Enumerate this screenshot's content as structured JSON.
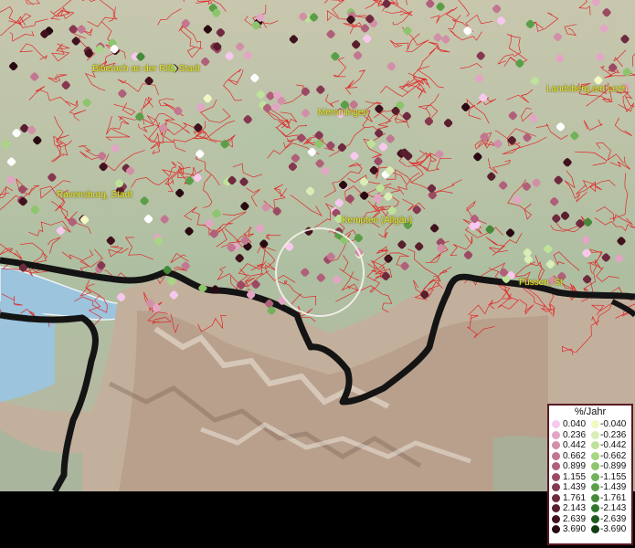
{
  "legend": {
    "title": "%/Jahr",
    "rows": [
      {
        "pos": "0.040",
        "neg": "-0.040",
        "posColor": "#f7c8ee",
        "negColor": "#f2f7c3"
      },
      {
        "pos": "0.236",
        "neg": "-0.236",
        "posColor": "#e2a6c4",
        "negColor": "#d8eeb4"
      },
      {
        "pos": "0.442",
        "neg": "-0.442",
        "posColor": "#d190a8",
        "negColor": "#bfe29a"
      },
      {
        "pos": "0.662",
        "neg": "-0.662",
        "posColor": "#c27690",
        "negColor": "#a8d684"
      },
      {
        "pos": "0.899",
        "neg": "-0.899",
        "posColor": "#b0607a",
        "negColor": "#8cc56c"
      },
      {
        "pos": "1.155",
        "neg": "-1.155",
        "posColor": "#9c4a64",
        "negColor": "#72b25a"
      },
      {
        "pos": "1.439",
        "neg": "-1.439",
        "posColor": "#863850",
        "negColor": "#5a9f48"
      },
      {
        "pos": "1.761",
        "neg": "-1.761",
        "posColor": "#6e2a3e",
        "negColor": "#448a38"
      },
      {
        "pos": "2.143",
        "neg": "-2.143",
        "posColor": "#581e2e",
        "negColor": "#2f7428"
      },
      {
        "pos": "2.639",
        "neg": "-2.639",
        "posColor": "#40121e",
        "negColor": "#1f5a1c"
      },
      {
        "pos": "3.690",
        "neg": "-3.690",
        "posColor": "#2a0a12",
        "negColor": "#123c10"
      }
    ]
  },
  "places": [
    {
      "name": "Biberach an der Riß, Stadt"
    },
    {
      "name": "Memmingen"
    },
    {
      "name": "Landsberg am Lech"
    },
    {
      "name": "Ravensburg, Stadt"
    },
    {
      "name": "Kempten (Allgäu)"
    },
    {
      "name": "Füssen, St"
    }
  ],
  "colors": {
    "boundary": "#e0282a",
    "border": "#111111",
    "lake": "#9cc4dc"
  }
}
